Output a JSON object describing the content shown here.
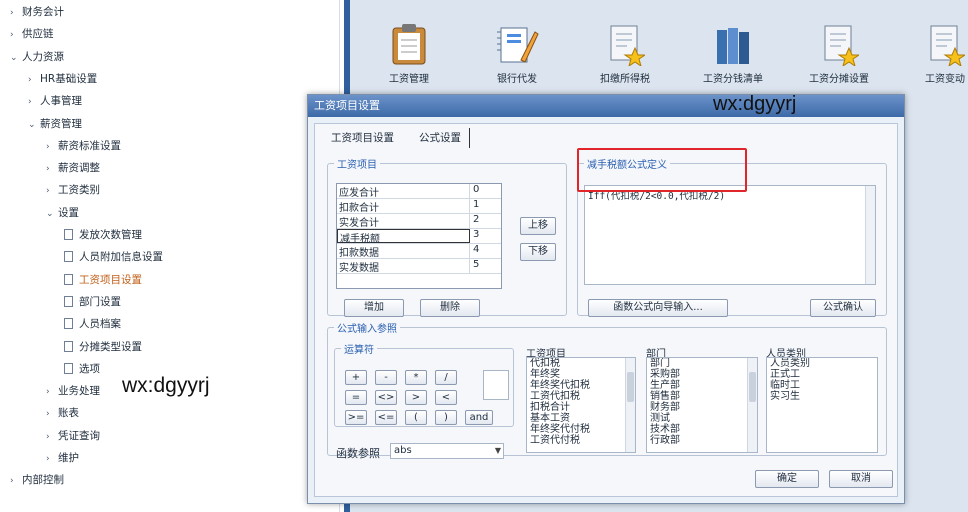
{
  "sidebar": {
    "items": [
      {
        "label": "财务会计",
        "arrow": "›"
      },
      {
        "label": "供应链",
        "arrow": "›"
      },
      {
        "label": "人力资源",
        "arrow": "⌄"
      },
      {
        "label": "HR基础设置",
        "arrow": "›"
      },
      {
        "label": "人事管理",
        "arrow": "›"
      },
      {
        "label": "薪资管理",
        "arrow": "⌄"
      },
      {
        "label": "薪资标准设置",
        "arrow": "›"
      },
      {
        "label": "薪资调整",
        "arrow": "›"
      },
      {
        "label": "工资类别",
        "arrow": "›"
      },
      {
        "label": "设置",
        "arrow": "⌄"
      },
      {
        "label": "发放次数管理"
      },
      {
        "label": "人员附加信息设置"
      },
      {
        "label": "工资项目设置"
      },
      {
        "label": "部门设置"
      },
      {
        "label": "人员档案"
      },
      {
        "label": "分摊类型设置"
      },
      {
        "label": "选项"
      },
      {
        "label": "业务处理",
        "arrow": "›"
      },
      {
        "label": "账表",
        "arrow": "›"
      },
      {
        "label": "凭证查询",
        "arrow": "›"
      },
      {
        "label": "维护",
        "arrow": "›"
      },
      {
        "label": "内部控制",
        "arrow": "›"
      }
    ],
    "watermark": "wx:dgyyrj"
  },
  "desktop": {
    "icons": [
      {
        "label": "工资管理",
        "icon": "clipboard-icon"
      },
      {
        "label": "银行代发",
        "icon": "notebook-pencil-icon"
      },
      {
        "label": "扣缴所得税",
        "icon": "document-star-icon"
      },
      {
        "label": "工资分钱清单",
        "icon": "books-icon"
      },
      {
        "label": "工资分摊设置",
        "icon": "document-star-icon"
      },
      {
        "label": "工资变动",
        "icon": "document-star-icon"
      }
    ]
  },
  "dialog": {
    "title": "工资项目设置",
    "watermark": "wx:dgyyrj",
    "tabs": [
      "工资项目设置",
      "公式设置"
    ],
    "salary_items_legend": "工资项目",
    "salary_items": [
      {
        "name": "应发合计",
        "value": "0"
      },
      {
        "name": "扣款合计",
        "value": "1"
      },
      {
        "name": "实发合计",
        "value": "2"
      },
      {
        "name": "减手税额",
        "value": "3"
      },
      {
        "name": "扣款数据",
        "value": "4"
      },
      {
        "name": "实发数据",
        "value": "5"
      }
    ],
    "move_up": "上移",
    "move_down": "下移",
    "add": "增加",
    "delete": "删除",
    "formula_legend": "减手税额公式定义",
    "formula_text": "Iff(代扣税/2<0.0,代扣税/2)",
    "function_wizard": "函数公式向导输入...",
    "formula_confirm": "公式确认",
    "input_ref_legend": "公式输入参照",
    "operators_legend": "运算符",
    "operators": [
      "+",
      "-",
      "*",
      "/",
      "=",
      "<>",
      ">",
      "<",
      ">=",
      "<=",
      "(",
      ")",
      "and"
    ],
    "function_ref_label": "函数参照",
    "function_ref_value": "abs",
    "col_salary_items": "工资项目",
    "salary_item_list": [
      "代扣税",
      "年终奖",
      "年终奖代扣税",
      "工资代扣税",
      "扣税合计",
      "基本工资",
      "年终奖代付税",
      "工资代付税"
    ],
    "col_department": "部门",
    "department_list": [
      "部门",
      "采购部",
      "生产部",
      "销售部",
      "财务部",
      "测试",
      "技术部",
      "行政部"
    ],
    "col_person_category": "人员类别",
    "person_category_list": [
      "人员类别",
      "正式工",
      "临时工",
      "实习生"
    ],
    "ok": "确定",
    "cancel": "取消"
  },
  "colors": {
    "accent": "#2a5fb0",
    "highlight_box": "#e0262a",
    "title_bar": "#3d6aa8",
    "active_tree_item": "#c0601a"
  }
}
